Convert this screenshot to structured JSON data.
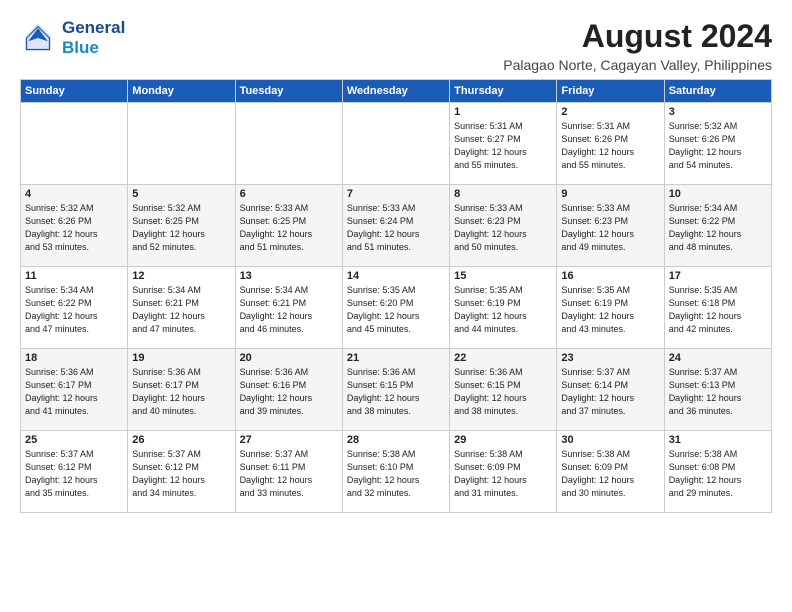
{
  "logo": {
    "line1": "General",
    "line2": "Blue"
  },
  "title": "August 2024",
  "subtitle": "Palagao Norte, Cagayan Valley, Philippines",
  "days_of_week": [
    "Sunday",
    "Monday",
    "Tuesday",
    "Wednesday",
    "Thursday",
    "Friday",
    "Saturday"
  ],
  "weeks": [
    [
      {
        "day": "",
        "info": ""
      },
      {
        "day": "",
        "info": ""
      },
      {
        "day": "",
        "info": ""
      },
      {
        "day": "",
        "info": ""
      },
      {
        "day": "1",
        "info": "Sunrise: 5:31 AM\nSunset: 6:27 PM\nDaylight: 12 hours\nand 55 minutes."
      },
      {
        "day": "2",
        "info": "Sunrise: 5:31 AM\nSunset: 6:26 PM\nDaylight: 12 hours\nand 55 minutes."
      },
      {
        "day": "3",
        "info": "Sunrise: 5:32 AM\nSunset: 6:26 PM\nDaylight: 12 hours\nand 54 minutes."
      }
    ],
    [
      {
        "day": "4",
        "info": "Sunrise: 5:32 AM\nSunset: 6:26 PM\nDaylight: 12 hours\nand 53 minutes."
      },
      {
        "day": "5",
        "info": "Sunrise: 5:32 AM\nSunset: 6:25 PM\nDaylight: 12 hours\nand 52 minutes."
      },
      {
        "day": "6",
        "info": "Sunrise: 5:33 AM\nSunset: 6:25 PM\nDaylight: 12 hours\nand 51 minutes."
      },
      {
        "day": "7",
        "info": "Sunrise: 5:33 AM\nSunset: 6:24 PM\nDaylight: 12 hours\nand 51 minutes."
      },
      {
        "day": "8",
        "info": "Sunrise: 5:33 AM\nSunset: 6:23 PM\nDaylight: 12 hours\nand 50 minutes."
      },
      {
        "day": "9",
        "info": "Sunrise: 5:33 AM\nSunset: 6:23 PM\nDaylight: 12 hours\nand 49 minutes."
      },
      {
        "day": "10",
        "info": "Sunrise: 5:34 AM\nSunset: 6:22 PM\nDaylight: 12 hours\nand 48 minutes."
      }
    ],
    [
      {
        "day": "11",
        "info": "Sunrise: 5:34 AM\nSunset: 6:22 PM\nDaylight: 12 hours\nand 47 minutes."
      },
      {
        "day": "12",
        "info": "Sunrise: 5:34 AM\nSunset: 6:21 PM\nDaylight: 12 hours\nand 47 minutes."
      },
      {
        "day": "13",
        "info": "Sunrise: 5:34 AM\nSunset: 6:21 PM\nDaylight: 12 hours\nand 46 minutes."
      },
      {
        "day": "14",
        "info": "Sunrise: 5:35 AM\nSunset: 6:20 PM\nDaylight: 12 hours\nand 45 minutes."
      },
      {
        "day": "15",
        "info": "Sunrise: 5:35 AM\nSunset: 6:19 PM\nDaylight: 12 hours\nand 44 minutes."
      },
      {
        "day": "16",
        "info": "Sunrise: 5:35 AM\nSunset: 6:19 PM\nDaylight: 12 hours\nand 43 minutes."
      },
      {
        "day": "17",
        "info": "Sunrise: 5:35 AM\nSunset: 6:18 PM\nDaylight: 12 hours\nand 42 minutes."
      }
    ],
    [
      {
        "day": "18",
        "info": "Sunrise: 5:36 AM\nSunset: 6:17 PM\nDaylight: 12 hours\nand 41 minutes."
      },
      {
        "day": "19",
        "info": "Sunrise: 5:36 AM\nSunset: 6:17 PM\nDaylight: 12 hours\nand 40 minutes."
      },
      {
        "day": "20",
        "info": "Sunrise: 5:36 AM\nSunset: 6:16 PM\nDaylight: 12 hours\nand 39 minutes."
      },
      {
        "day": "21",
        "info": "Sunrise: 5:36 AM\nSunset: 6:15 PM\nDaylight: 12 hours\nand 38 minutes."
      },
      {
        "day": "22",
        "info": "Sunrise: 5:36 AM\nSunset: 6:15 PM\nDaylight: 12 hours\nand 38 minutes."
      },
      {
        "day": "23",
        "info": "Sunrise: 5:37 AM\nSunset: 6:14 PM\nDaylight: 12 hours\nand 37 minutes."
      },
      {
        "day": "24",
        "info": "Sunrise: 5:37 AM\nSunset: 6:13 PM\nDaylight: 12 hours\nand 36 minutes."
      }
    ],
    [
      {
        "day": "25",
        "info": "Sunrise: 5:37 AM\nSunset: 6:12 PM\nDaylight: 12 hours\nand 35 minutes."
      },
      {
        "day": "26",
        "info": "Sunrise: 5:37 AM\nSunset: 6:12 PM\nDaylight: 12 hours\nand 34 minutes."
      },
      {
        "day": "27",
        "info": "Sunrise: 5:37 AM\nSunset: 6:11 PM\nDaylight: 12 hours\nand 33 minutes."
      },
      {
        "day": "28",
        "info": "Sunrise: 5:38 AM\nSunset: 6:10 PM\nDaylight: 12 hours\nand 32 minutes."
      },
      {
        "day": "29",
        "info": "Sunrise: 5:38 AM\nSunset: 6:09 PM\nDaylight: 12 hours\nand 31 minutes."
      },
      {
        "day": "30",
        "info": "Sunrise: 5:38 AM\nSunset: 6:09 PM\nDaylight: 12 hours\nand 30 minutes."
      },
      {
        "day": "31",
        "info": "Sunrise: 5:38 AM\nSunset: 6:08 PM\nDaylight: 12 hours\nand 29 minutes."
      }
    ]
  ]
}
